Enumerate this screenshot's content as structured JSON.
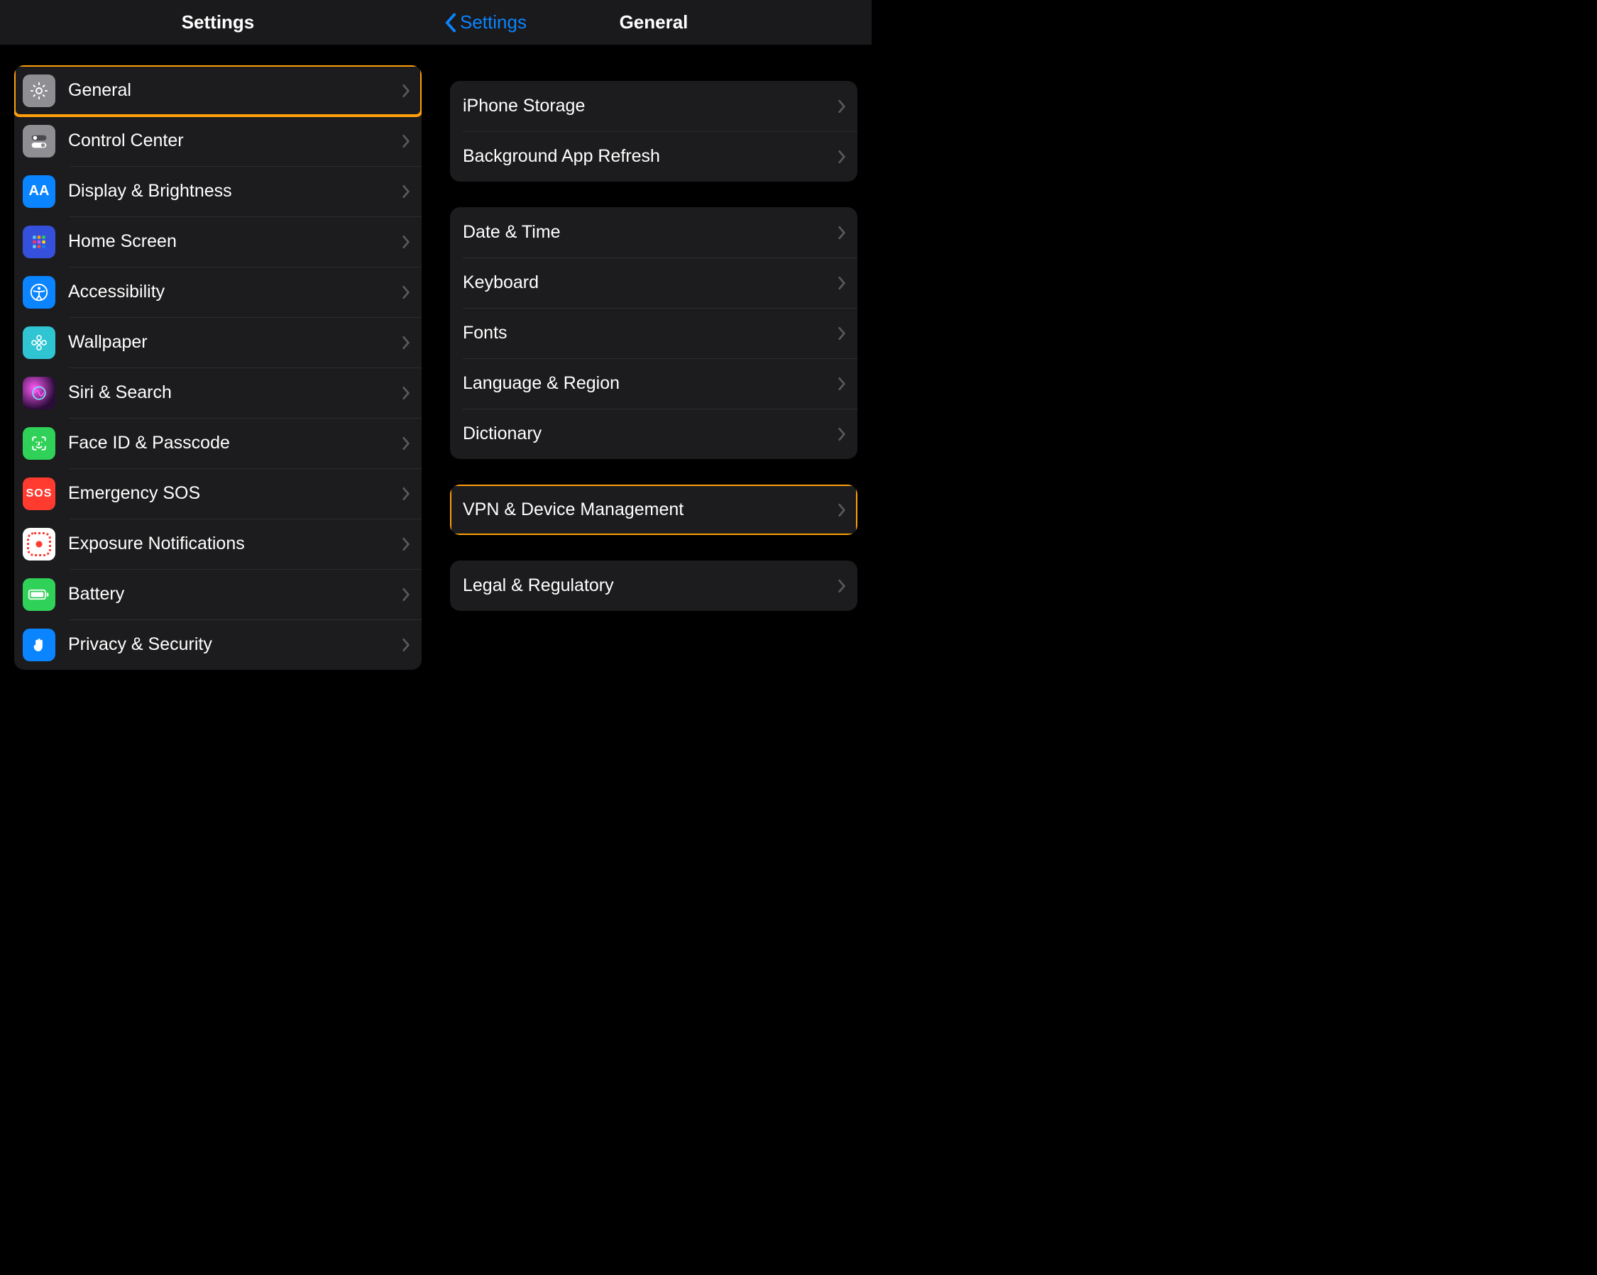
{
  "left": {
    "title": "Settings",
    "items": [
      {
        "id": "general",
        "label": "General",
        "icon": "gear-icon",
        "highlight": true
      },
      {
        "id": "control",
        "label": "Control Center",
        "icon": "switches-icon",
        "highlight": false
      },
      {
        "id": "display",
        "label": "Display & Brightness",
        "icon": "text-size-icon",
        "highlight": false
      },
      {
        "id": "home",
        "label": "Home Screen",
        "icon": "grid-icon",
        "highlight": false
      },
      {
        "id": "access",
        "label": "Accessibility",
        "icon": "accessibility-icon",
        "highlight": false
      },
      {
        "id": "wall",
        "label": "Wallpaper",
        "icon": "flower-icon",
        "highlight": false
      },
      {
        "id": "siri",
        "label": "Siri & Search",
        "icon": "siri-icon",
        "highlight": false
      },
      {
        "id": "faceid",
        "label": "Face ID & Passcode",
        "icon": "faceid-icon",
        "highlight": false
      },
      {
        "id": "sos",
        "label": "Emergency SOS",
        "icon": "sos-icon",
        "highlight": false
      },
      {
        "id": "exposure",
        "label": "Exposure Notifications",
        "icon": "exposure-icon",
        "highlight": false
      },
      {
        "id": "battery",
        "label": "Battery",
        "icon": "battery-icon",
        "highlight": false
      },
      {
        "id": "privacy",
        "label": "Privacy & Security",
        "icon": "hand-icon",
        "highlight": false
      }
    ]
  },
  "right": {
    "back_label": "Settings",
    "title": "General",
    "groups": [
      {
        "items": [
          {
            "id": "storage",
            "label": "iPhone Storage",
            "highlight": false
          },
          {
            "id": "bgapp",
            "label": "Background App Refresh",
            "highlight": false
          }
        ]
      },
      {
        "items": [
          {
            "id": "date",
            "label": "Date & Time",
            "highlight": false
          },
          {
            "id": "keyb",
            "label": "Keyboard",
            "highlight": false
          },
          {
            "id": "fonts",
            "label": "Fonts",
            "highlight": false
          },
          {
            "id": "lang",
            "label": "Language & Region",
            "highlight": false
          },
          {
            "id": "dict",
            "label": "Dictionary",
            "highlight": false
          }
        ]
      },
      {
        "items": [
          {
            "id": "vpn",
            "label": "VPN & Device Management",
            "highlight": true
          }
        ]
      },
      {
        "items": [
          {
            "id": "legal",
            "label": "Legal & Regulatory",
            "highlight": false
          }
        ]
      }
    ]
  },
  "colors": {
    "highlight": "#ff9f0a",
    "link": "#0a84ff"
  }
}
